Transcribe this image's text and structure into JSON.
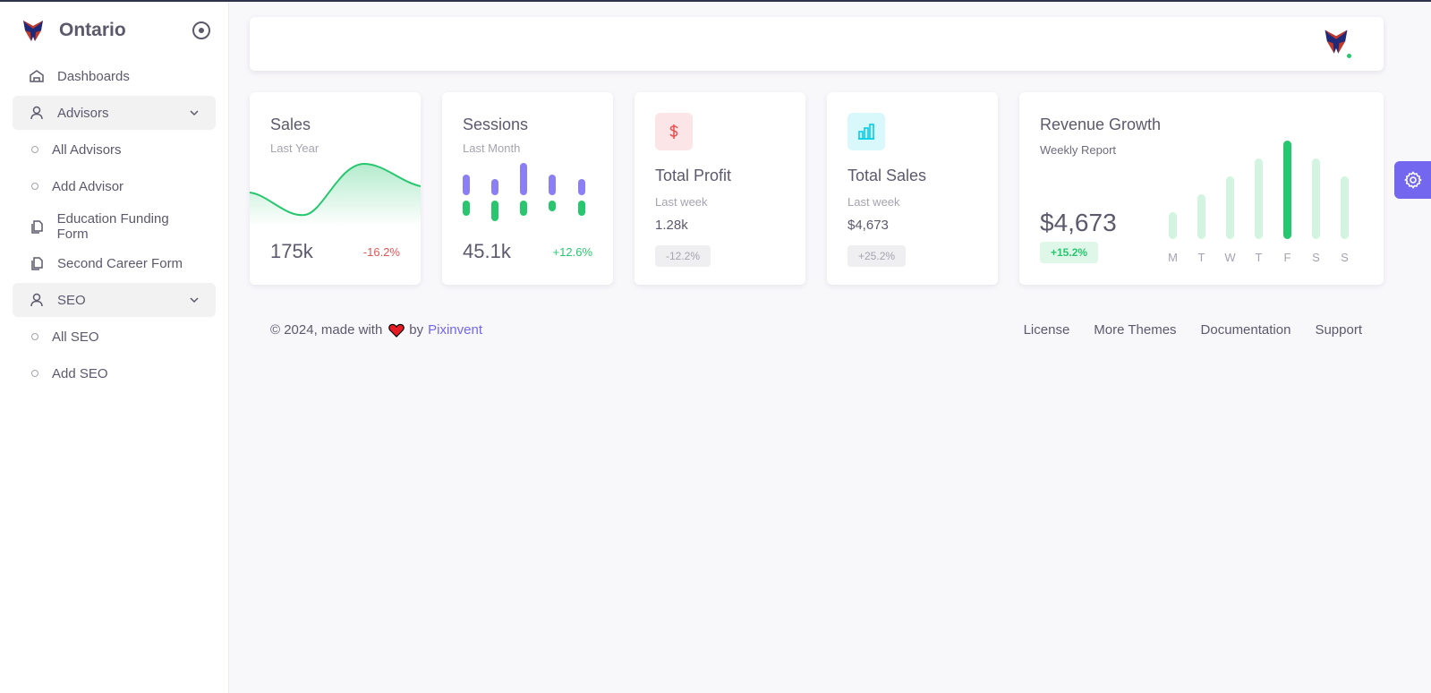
{
  "brand": {
    "name": "Ontario"
  },
  "sidebar": {
    "items": [
      {
        "label": "Dashboards"
      },
      {
        "label": "Advisors"
      },
      {
        "label": "All Advisors"
      },
      {
        "label": "Add Advisor"
      },
      {
        "label": "Education Funding Form"
      },
      {
        "label": "Second Career Form"
      },
      {
        "label": "SEO"
      },
      {
        "label": "All SEO"
      },
      {
        "label": "Add SEO"
      }
    ]
  },
  "cards": {
    "sales": {
      "title": "Sales",
      "subtitle": "Last Year",
      "value": "175k",
      "change": "-16.2%"
    },
    "sessions": {
      "title": "Sessions",
      "subtitle": "Last Month",
      "value": "45.1k",
      "change": "+12.6%"
    },
    "profit": {
      "title": "Total Profit",
      "subtitle": "Last week",
      "value": "1.28k",
      "change": "-12.2%"
    },
    "total_sales": {
      "title": "Total Sales",
      "subtitle": "Last week",
      "value": "$4,673",
      "change": "+25.2%"
    },
    "revenue": {
      "title": "Revenue Growth",
      "subtitle": "Weekly Report",
      "value": "$4,673",
      "change": "+15.2%"
    }
  },
  "chart_data": [
    {
      "type": "bar",
      "categories": [
        "M",
        "T",
        "W",
        "T",
        "F",
        "S",
        "S"
      ],
      "values": [
        30,
        50,
        70,
        90,
        110,
        90,
        70
      ],
      "highlight_index": 4
    }
  ],
  "footer": {
    "copyright_prefix": "© 2024, made with",
    "by": "by",
    "author": "Pixinvent",
    "links": [
      "License",
      "More Themes",
      "Documentation",
      "Support"
    ]
  },
  "colors": {
    "primary": "#7367f0",
    "success": "#28c76f",
    "danger": "#ea5455",
    "info": "#00cfe8"
  },
  "icons": {
    "brand": "trillium-logo-icon",
    "settings": "gear-icon"
  }
}
